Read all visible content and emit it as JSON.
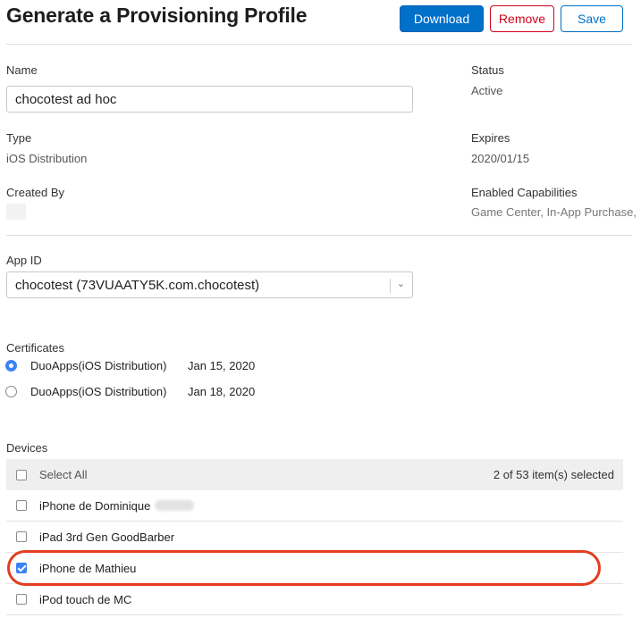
{
  "header": {
    "title": "Generate a Provisioning Profile",
    "download_label": "Download",
    "remove_label": "Remove",
    "save_label": "Save"
  },
  "profile": {
    "name_label": "Name",
    "name_value": "chocotest ad hoc",
    "status_label": "Status",
    "status_value": "Active",
    "type_label": "Type",
    "type_value": "iOS Distribution",
    "expires_label": "Expires",
    "expires_value": "2020/01/15",
    "created_by_label": "Created By",
    "capabilities_label": "Enabled Capabilities",
    "capabilities_value": "Game Center, In-App Purchase,"
  },
  "app_id": {
    "label": "App ID",
    "selected": "chocotest (73VUAATY5K.com.chocotest)"
  },
  "certificates": {
    "label": "Certificates",
    "items": [
      {
        "name": "DuoApps(iOS Distribution)",
        "date": "Jan 15, 2020",
        "selected": true
      },
      {
        "name": "DuoApps(iOS Distribution)",
        "date": "Jan 18, 2020",
        "selected": false
      }
    ]
  },
  "devices": {
    "label": "Devices",
    "select_all_label": "Select All",
    "count_text": "2 of 53 item(s) selected",
    "items": [
      {
        "name": "iPhone de Dominique",
        "checked": false
      },
      {
        "name": "iPad 3rd Gen GoodBarber",
        "checked": false
      },
      {
        "name": "iPhone de Mathieu",
        "checked": true
      },
      {
        "name": "iPod touch de MC",
        "checked": false
      }
    ]
  },
  "colors": {
    "primary": "#0070c9",
    "danger": "#d0021b",
    "highlight": "#e43d1f",
    "checked": "#3b82f6"
  }
}
